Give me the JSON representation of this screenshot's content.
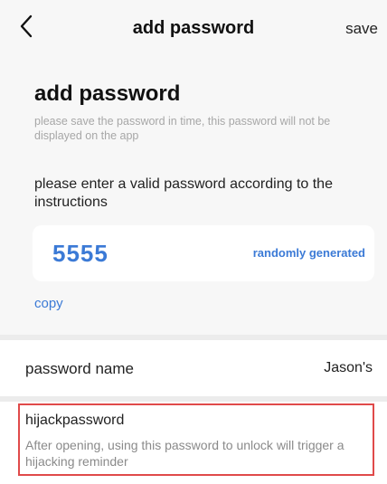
{
  "header": {
    "title": "add password",
    "save_label": "save",
    "back_icon": "chevron-left-icon"
  },
  "content": {
    "heading": "add password",
    "hint": "please save the password in time, this password will not be displayed on the app",
    "instruction": "please enter a valid password according to the instructions",
    "password_value": "5555",
    "randomly_generated_label": "randomly generated",
    "copy_label": "copy"
  },
  "fields": {
    "password_name_label": "password name",
    "password_name_value": "Jason's"
  },
  "hijack": {
    "title": "hijackpassword",
    "description": "After opening, using this password to unlock will trigger a hijacking reminder"
  },
  "colors": {
    "accent": "#3b7ad6",
    "highlight_border": "#e04a4a",
    "background": "#f7f7f7"
  }
}
